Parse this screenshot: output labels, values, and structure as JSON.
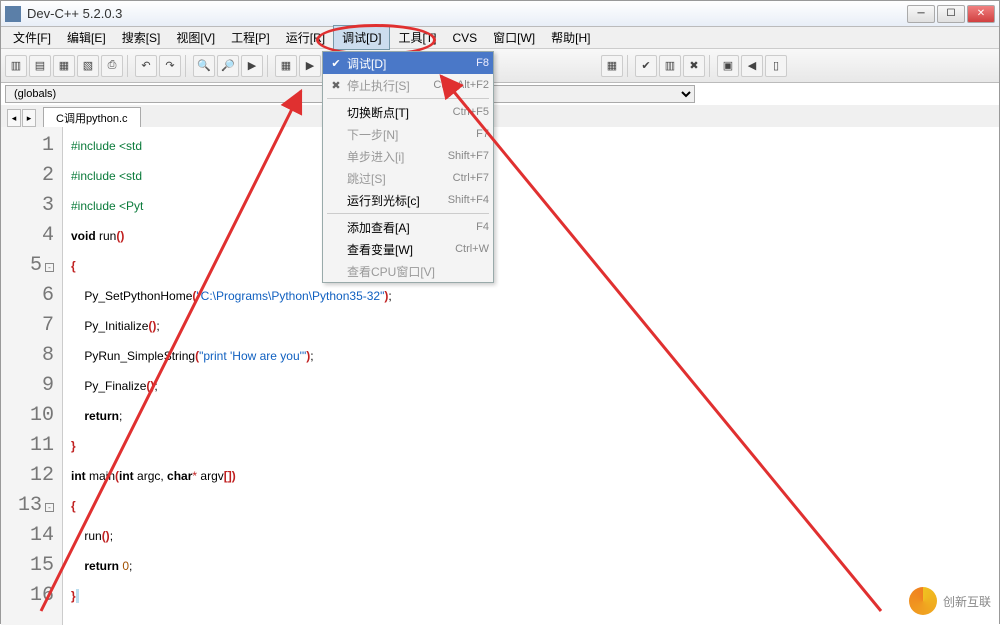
{
  "window": {
    "title": "Dev-C++ 5.2.0.3"
  },
  "menubar": [
    "文件[F]",
    "编辑[E]",
    "搜索[S]",
    "视图[V]",
    "工程[P]",
    "运行[R]",
    "调试[D]",
    "工具[T]",
    "CVS",
    "窗口[W]",
    "帮助[H]"
  ],
  "active_menu_index": 6,
  "globals_label": "(globals)",
  "tab": {
    "label": "C调用python.c"
  },
  "dropdown": [
    {
      "icon": "✔",
      "label": "调试[D]",
      "shortcut": "F8",
      "highlight": true,
      "disabled": false
    },
    {
      "icon": "✖",
      "label": "停止执行[S]",
      "shortcut": "Ctrl+Alt+F2",
      "highlight": false,
      "disabled": true
    },
    {
      "sep": true
    },
    {
      "icon": "",
      "label": "切换断点[T]",
      "shortcut": "Ctrl+F5",
      "highlight": false,
      "disabled": false
    },
    {
      "icon": "",
      "label": "下一步[N]",
      "shortcut": "F7",
      "highlight": false,
      "disabled": true
    },
    {
      "icon": "",
      "label": "单步进入[i]",
      "shortcut": "Shift+F7",
      "highlight": false,
      "disabled": true
    },
    {
      "icon": "",
      "label": "跳过[S]",
      "shortcut": "Ctrl+F7",
      "highlight": false,
      "disabled": true
    },
    {
      "icon": "",
      "label": "运行到光标[c]",
      "shortcut": "Shift+F4",
      "highlight": false,
      "disabled": false
    },
    {
      "sep": true
    },
    {
      "icon": "",
      "label": "添加查看[A]",
      "shortcut": "F4",
      "highlight": false,
      "disabled": false
    },
    {
      "icon": "",
      "label": "查看变量[W]",
      "shortcut": "Ctrl+W",
      "highlight": false,
      "disabled": false
    },
    {
      "icon": "",
      "label": "查看CPU窗口[V]",
      "shortcut": "",
      "highlight": false,
      "disabled": true
    }
  ],
  "code": {
    "lines": [
      {
        "n": 1,
        "html": "<span class='pp'>#include &lt;std</span>"
      },
      {
        "n": 2,
        "html": "<span class='pp'>#include &lt;std</span>"
      },
      {
        "n": 3,
        "html": "<span class='pp'>#include &lt;Pyt</span>"
      },
      {
        "n": 4,
        "html": "<span class='kw'>void</span> run<span class='br'>()</span>"
      },
      {
        "n": 5,
        "html": "<span class='br'>{</span>",
        "fold": true
      },
      {
        "n": 6,
        "html": "    Py_SetPythonHome<span class='br'>(</span><span class='str'>\"C:\\Programs\\Python\\Python35-32\"</span><span class='br'>)</span>;"
      },
      {
        "n": 7,
        "html": "    Py_Initialize<span class='br'>()</span>;"
      },
      {
        "n": 8,
        "html": "    PyRun_SimpleString<span class='br'>(</span><span class='str'>\"print 'How are you'\"</span><span class='br'>)</span>;"
      },
      {
        "n": 9,
        "html": "    Py_Finalize<span class='br'>()</span>;"
      },
      {
        "n": 10,
        "html": "    <span class='kw'>return</span>;"
      },
      {
        "n": 11,
        "html": "<span class='br'>}</span>"
      },
      {
        "n": 12,
        "html": "<span class='kw'>int</span> main<span class='br'>(</span><span class='kw'>int</span> argc, <span class='kw'>char</span><span class='op'>*</span> argv<span class='br'>[])</span>"
      },
      {
        "n": 13,
        "html": "<span class='br'>{</span>",
        "fold": true
      },
      {
        "n": 14,
        "html": "    run<span class='br'>()</span>;"
      },
      {
        "n": 15,
        "html": "    <span class='kw'>return</span> <span class='num'>0</span>;"
      },
      {
        "n": 16,
        "html": "<span class='br'>}</span><span style='background:#bde'>&nbsp;</span>"
      }
    ]
  },
  "watermark": "创新互联"
}
